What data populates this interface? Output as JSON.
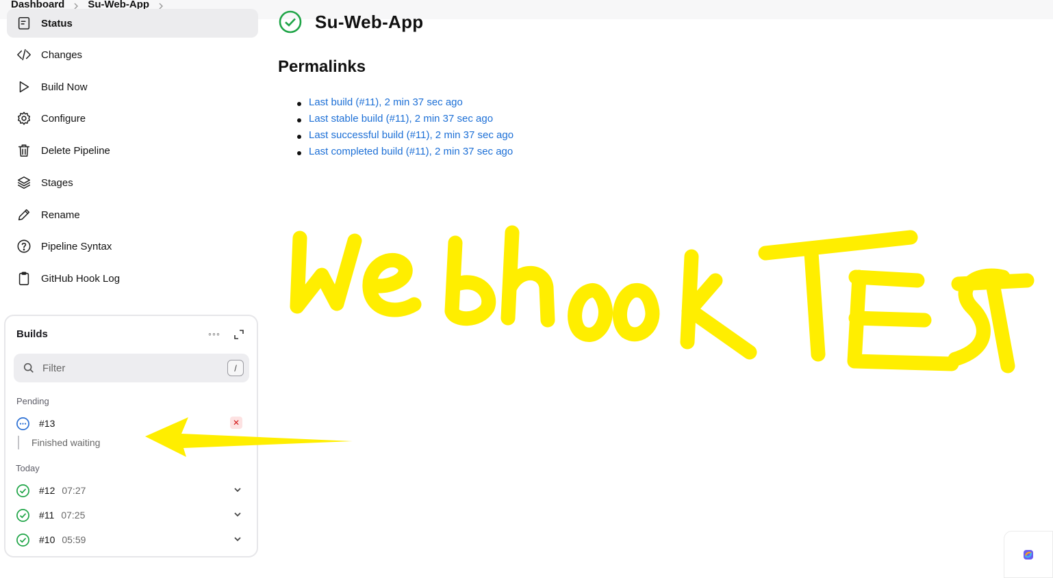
{
  "breadcrumb": {
    "items": [
      "Dashboard",
      "Su-Web-App"
    ]
  },
  "sidebar": {
    "items": [
      {
        "label": "Status",
        "icon": "status-icon",
        "active": true
      },
      {
        "label": "Changes",
        "icon": "code-icon"
      },
      {
        "label": "Build Now",
        "icon": "play-icon"
      },
      {
        "label": "Configure",
        "icon": "gear-icon"
      },
      {
        "label": "Delete Pipeline",
        "icon": "trash-icon"
      },
      {
        "label": "Stages",
        "icon": "layers-icon"
      },
      {
        "label": "Rename",
        "icon": "pencil-icon"
      },
      {
        "label": "Pipeline Syntax",
        "icon": "help-icon"
      },
      {
        "label": "GitHub Hook Log",
        "icon": "clipboard-icon"
      }
    ]
  },
  "builds": {
    "title": "Builds",
    "filter_placeholder": "Filter",
    "filter_shortcut": "/",
    "pending_label": "Pending",
    "pending": {
      "number": "#13",
      "substatus": "Finished waiting",
      "status": "pending"
    },
    "today_label": "Today",
    "rows": [
      {
        "number": "#12",
        "time": "07:27",
        "status": "success"
      },
      {
        "number": "#11",
        "time": "07:25",
        "status": "success"
      },
      {
        "number": "#10",
        "time": "05:59",
        "status": "success"
      }
    ]
  },
  "main": {
    "title": "Su-Web-App",
    "status": "success",
    "permalinks_heading": "Permalinks",
    "permalinks": [
      "Last build (#11), 2 min 37 sec ago",
      "Last stable build (#11), 2 min 37 sec ago",
      "Last successful build (#11), 2 min 37 sec ago",
      "Last completed build (#11), 2 min 37 sec ago"
    ]
  },
  "annotation": {
    "text": "Webhook TEST",
    "color": "#ffee00"
  },
  "colors": {
    "link": "#1c6fd6",
    "success": "#1ea446",
    "pending": "#2a6fd4",
    "cancel": "#d31b1b"
  }
}
